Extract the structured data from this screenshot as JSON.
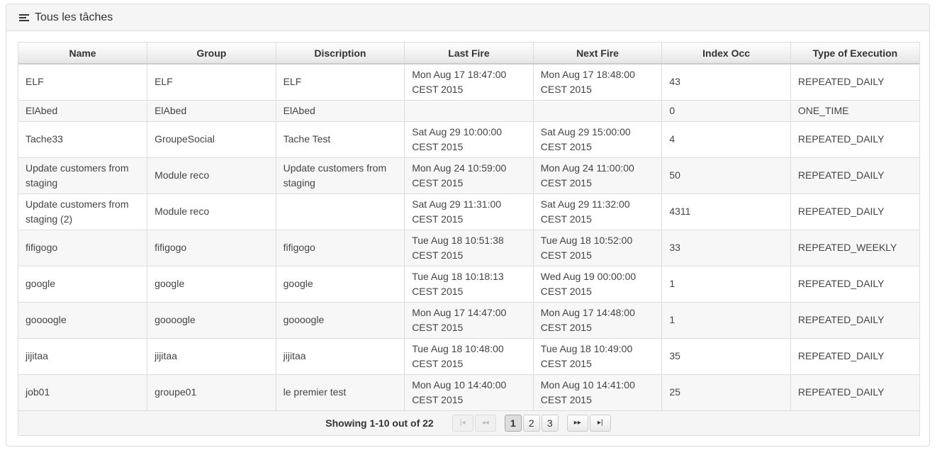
{
  "panel": {
    "title": "Tous les tâches",
    "icon": "tasks-icon"
  },
  "table": {
    "headers": [
      "Name",
      "Group",
      "Discription",
      "Last Fire",
      "Next Fire",
      "Index Occ",
      "Type of Execution"
    ],
    "rows": [
      {
        "name": "ELF",
        "group": "ELF",
        "description": "ELF",
        "last_fire": "Mon Aug 17 18:47:00 CEST 2015",
        "next_fire": "Mon Aug 17 18:48:00 CEST 2015",
        "index_occ": "43",
        "type": "REPEATED_DAILY"
      },
      {
        "name": "ElAbed",
        "group": "ElAbed",
        "description": "ElAbed",
        "last_fire": "",
        "next_fire": "",
        "index_occ": "0",
        "type": "ONE_TIME"
      },
      {
        "name": "Tache33",
        "group": "GroupeSocial",
        "description": "Tache Test",
        "last_fire": "Sat Aug 29 10:00:00 CEST 2015",
        "next_fire": "Sat Aug 29 15:00:00 CEST 2015",
        "index_occ": "4",
        "type": "REPEATED_DAILY"
      },
      {
        "name": "Update customers from staging",
        "group": "Module reco",
        "description": "Update customers from staging",
        "last_fire": "Mon Aug 24 10:59:00 CEST 2015",
        "next_fire": "Mon Aug 24 11:00:00 CEST 2015",
        "index_occ": "50",
        "type": "REPEATED_DAILY"
      },
      {
        "name": "Update customers from staging (2)",
        "group": "Module reco",
        "description": "",
        "last_fire": "Sat Aug 29 11:31:00 CEST 2015",
        "next_fire": "Sat Aug 29 11:32:00 CEST 2015",
        "index_occ": "4311",
        "type": "REPEATED_DAILY"
      },
      {
        "name": "fifigogo",
        "group": "fifigogo",
        "description": "fifigogo",
        "last_fire": "Tue Aug 18 10:51:38 CEST 2015",
        "next_fire": "Tue Aug 18 10:52:00 CEST 2015",
        "index_occ": "33",
        "type": "REPEATED_WEEKLY"
      },
      {
        "name": "google",
        "group": "google",
        "description": "google",
        "last_fire": "Tue Aug 18 10:18:13 CEST 2015",
        "next_fire": "Wed Aug 19 00:00:00 CEST 2015",
        "index_occ": "1",
        "type": "REPEATED_DAILY"
      },
      {
        "name": "goooogle",
        "group": "goooogle",
        "description": "goooogle",
        "last_fire": "Mon Aug 17 14:47:00 CEST 2015",
        "next_fire": "Mon Aug 17 14:48:00 CEST 2015",
        "index_occ": "1",
        "type": "REPEATED_DAILY"
      },
      {
        "name": "jijitaa",
        "group": "jijitaa",
        "description": "jijitaa",
        "last_fire": "Tue Aug 18 10:48:00 CEST 2015",
        "next_fire": "Tue Aug 18 10:49:00 CEST 2015",
        "index_occ": "35",
        "type": "REPEATED_DAILY"
      },
      {
        "name": "job01",
        "group": "groupe01",
        "description": "le premier test",
        "last_fire": "Mon Aug 10 14:40:00 CEST 2015",
        "next_fire": "Mon Aug 10 14:41:00 CEST 2015",
        "index_occ": "25",
        "type": "REPEATED_DAILY"
      }
    ]
  },
  "pager": {
    "status": "Showing 1-10 out of 22",
    "first_icon": "first-page-icon",
    "prev_icon": "prev-page-icon",
    "next_icon": "next-page-icon",
    "last_icon": "last-page-icon",
    "pages": [
      "1",
      "2",
      "3"
    ],
    "current_page": "1"
  }
}
